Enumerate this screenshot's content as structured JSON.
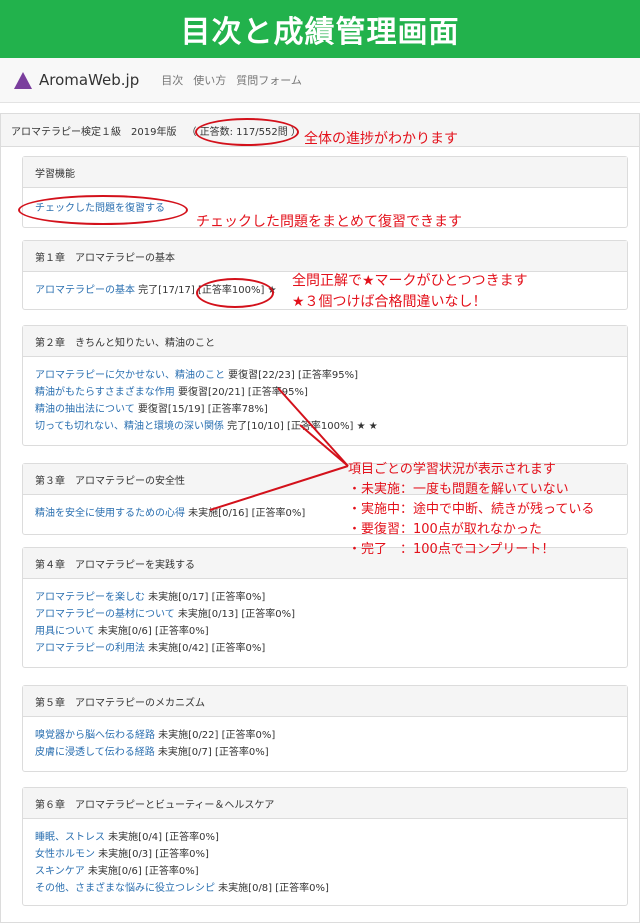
{
  "banner": {
    "title": "目次と成績管理画面"
  },
  "nav": {
    "brand": "AromaWeb.jp",
    "links": [
      "目次",
      "使い方",
      "質問フォーム"
    ]
  },
  "exam": {
    "title": "アロマテラピー検定１級　2019年版",
    "count": "（ 正答数: 117/552問 ）"
  },
  "review": {
    "heading": "学習機能",
    "link": "チェックした問題を復習する"
  },
  "chapters": [
    {
      "title": "第１章　アロマテラピーの基本",
      "items": [
        {
          "link": "アロマテラピーの基本",
          "status": " 完了[17/17]",
          "rate": "[正答率100%]",
          "stars": " ★"
        }
      ]
    },
    {
      "title": "第２章　きちんと知りたい、精油のこと",
      "items": [
        {
          "link": "アロマテラピーに欠かせない、精油のこと",
          "status": " 要復習[22/23]",
          "rate": "[正答率95%]",
          "stars": ""
        },
        {
          "link": "精油がもたらすさまざまな作用",
          "status": " 要復習[20/21]",
          "rate": "[正答率95%]",
          "stars": ""
        },
        {
          "link": "精油の抽出法について",
          "status": " 要復習[15/19]",
          "rate": "[正答率78%]",
          "stars": ""
        },
        {
          "link": "切っても切れない、精油と環境の深い関係",
          "status": " 完了[10/10]",
          "rate": "[正答率100%]",
          "stars": " ★ ★"
        }
      ]
    },
    {
      "title": "第３章　アロマテラピーの安全性",
      "items": [
        {
          "link": "精油を安全に使用するための心得",
          "status": " 未実施[0/16]",
          "rate": "[正答率0%]",
          "stars": ""
        }
      ]
    },
    {
      "title": "第４章　アロマテラピーを実践する",
      "items": [
        {
          "link": "アロマテラピーを楽しむ",
          "status": " 未実施[0/17]",
          "rate": "[正答率0%]",
          "stars": ""
        },
        {
          "link": "アロマテラピーの基材について",
          "status": " 未実施[0/13]",
          "rate": "[正答率0%]",
          "stars": ""
        },
        {
          "link": "用具について",
          "status": " 未実施[0/6]",
          "rate": "[正答率0%]",
          "stars": ""
        },
        {
          "link": "アロマテラピーの利用法",
          "status": " 未実施[0/42]",
          "rate": "[正答率0%]",
          "stars": ""
        }
      ]
    },
    {
      "title": "第５章　アロマテラピーのメカニズム",
      "items": [
        {
          "link": "嗅覚器から脳へ伝わる経路",
          "status": " 未実施[0/22]",
          "rate": "[正答率0%]",
          "stars": ""
        },
        {
          "link": "皮膚に浸透して伝わる経路",
          "status": " 未実施[0/7]",
          "rate": "[正答率0%]",
          "stars": ""
        }
      ]
    },
    {
      "title": "第６章　アロマテラピーとビューティー＆ヘルスケア",
      "items": [
        {
          "link": "睡眠、ストレス",
          "status": " 未実施[0/4]",
          "rate": "[正答率0%]",
          "stars": ""
        },
        {
          "link": "女性ホルモン",
          "status": " 未実施[0/3]",
          "rate": "[正答率0%]",
          "stars": ""
        },
        {
          "link": "スキンケア",
          "status": " 未実施[0/6]",
          "rate": "[正答率0%]",
          "stars": ""
        },
        {
          "link": "その他、さまざまな悩みに役立つレシピ",
          "status": " 未実施[0/8]",
          "rate": "[正答率0%]",
          "stars": ""
        }
      ]
    }
  ],
  "annotations": {
    "progress": "全体の進捗がわかります",
    "review": "チェックした問題をまとめて復習できます",
    "stars_1": "全問正解で★マークがひとつつきます",
    "stars_2": "★３個つけば合格間違いなし！",
    "status_title": "項目ごとの学習状況が表示されます",
    "status_lines": [
      "・未実施：一度も問題を解いていない",
      "・実施中：途中で中断、続きが残っている",
      "・要復習：100点が取れなかった",
      "・完了　：100点でコンプリート！"
    ]
  },
  "colors": {
    "banner": "#22b24c",
    "link": "#2a6fb0",
    "annotation": "#e3111b",
    "brand_icon": "#7a3e9d"
  }
}
